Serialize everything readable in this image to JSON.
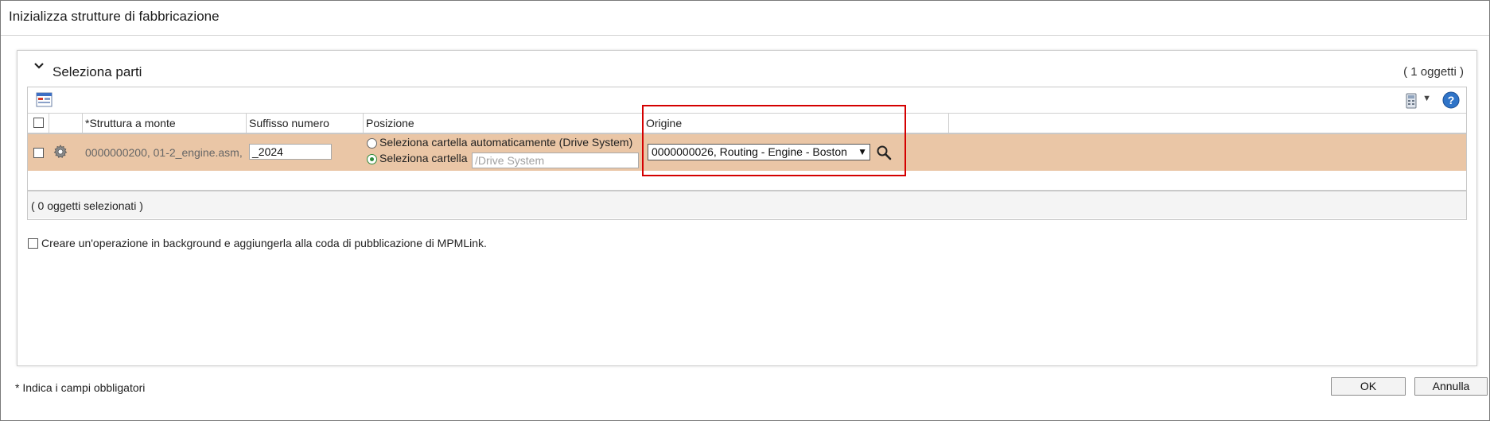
{
  "dialog": {
    "title": "Inizializza strutture di fabbricazione"
  },
  "panel": {
    "title": "Seleziona parti",
    "object_count": "( 1 oggetti )"
  },
  "table": {
    "columns": {
      "upstream": "*Struttura a monte",
      "suffix": "Suffisso numero",
      "position": "Posizione",
      "origin": "Origine"
    },
    "row": {
      "part": "0000000200, 01-2_engine.asm,",
      "suffix_value": "_2024",
      "position_auto_label": "Seleziona cartella automaticamente (Drive System)",
      "position_select_label": "Seleziona cartella",
      "folder_placeholder": "/Drive System",
      "origin_value": "0000000026, Routing - Engine - Boston"
    },
    "selected_count": "( 0 oggetti selezionati )"
  },
  "background_option": "Creare un'operazione in background e aggiungerla alla coda di pubblicazione di MPMLink.",
  "required_note": "* Indica i campi obbligatori",
  "buttons": {
    "ok": "OK",
    "cancel": "Annulla"
  },
  "colors": {
    "selected_row": "#eac6a6",
    "highlight_box": "#d40000",
    "radio_selected": "#2e8b3a"
  },
  "icons": [
    "chevron-down-icon",
    "table-options-icon",
    "calculator-icon",
    "help-icon",
    "gear-icon",
    "search-icon"
  ]
}
